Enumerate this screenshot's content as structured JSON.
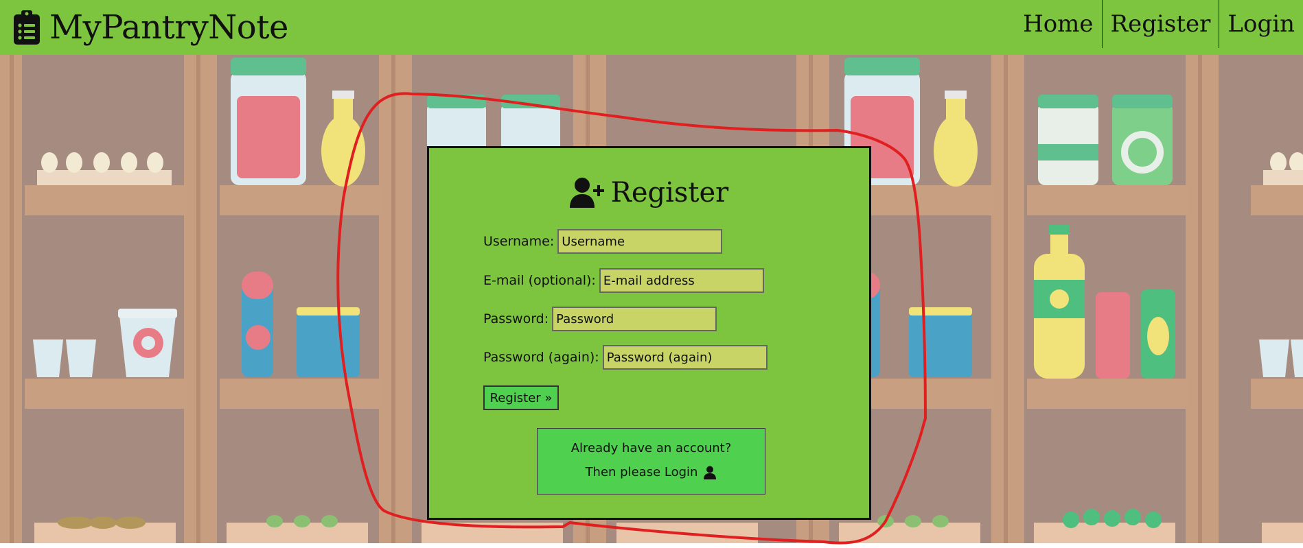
{
  "brand": {
    "name": "MyPantryNote",
    "icon": "clipboard-list-icon"
  },
  "nav": {
    "home": "Home",
    "register": "Register",
    "login": "Login"
  },
  "form": {
    "title": "Register",
    "title_icon": "user-plus-icon",
    "username_label": "Username:",
    "username_placeholder": "Username",
    "email_label": "E-mail (optional):",
    "email_placeholder": "E-mail address",
    "password_label": "Password:",
    "password_placeholder": "Password",
    "password2_label": "Password (again):",
    "password2_placeholder": "Password (again)",
    "submit_label": "Register »"
  },
  "login_prompt": {
    "line1": "Already have an account?",
    "line2": "Then please Login",
    "icon": "user-icon"
  },
  "colors": {
    "nav_bg": "#7dc43f",
    "panel_bg": "#7dc43f",
    "button_bg": "#4fd14f",
    "input_bg": "#c9d467",
    "annotation_red": "#e02020"
  }
}
